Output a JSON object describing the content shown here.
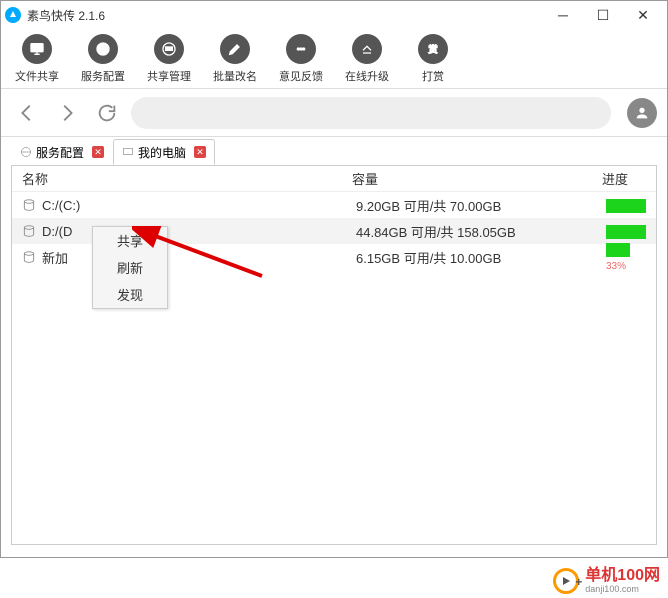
{
  "title": "素鸟快传 2.1.6",
  "toolbar": [
    {
      "label": "文件共享",
      "icon": "monitor",
      "name": "tool-file-share"
    },
    {
      "label": "服务配置",
      "icon": "www",
      "name": "tool-service-config"
    },
    {
      "label": "共享管理",
      "icon": "folder",
      "name": "tool-share-manage"
    },
    {
      "label": "批量改名",
      "icon": "pencil",
      "name": "tool-batch-rename"
    },
    {
      "label": "意见反馈",
      "icon": "chat",
      "name": "tool-feedback"
    },
    {
      "label": "在线升级",
      "icon": "upgrade",
      "name": "tool-upgrade"
    },
    {
      "label": "打赏",
      "icon": "reward",
      "name": "tool-reward"
    }
  ],
  "tabs": [
    {
      "label": "服务配置",
      "active": false,
      "name": "tab-service-config"
    },
    {
      "label": "我的电脑",
      "active": true,
      "name": "tab-my-computer"
    }
  ],
  "columns": {
    "name": "名称",
    "capacity": "容量",
    "progress": "进度"
  },
  "rows": [
    {
      "name": "C:/(C:)",
      "capacity": "9.20GB 可用/共 70.00GB",
      "progress_width": 40,
      "progress_text": "",
      "sel": false
    },
    {
      "name": "D:/(D",
      "capacity": "44.84GB 可用/共 158.05GB",
      "progress_width": 40,
      "progress_text": "",
      "sel": true
    },
    {
      "name": "新加",
      "capacity": "6.15GB 可用/共 10.00GB",
      "progress_width": 24,
      "progress_text": "33%",
      "sel": false
    }
  ],
  "context_menu": {
    "items": [
      "共享",
      "刷新",
      "发现"
    ]
  },
  "watermark": {
    "title": "单机100网",
    "sub": "danji100.com"
  }
}
